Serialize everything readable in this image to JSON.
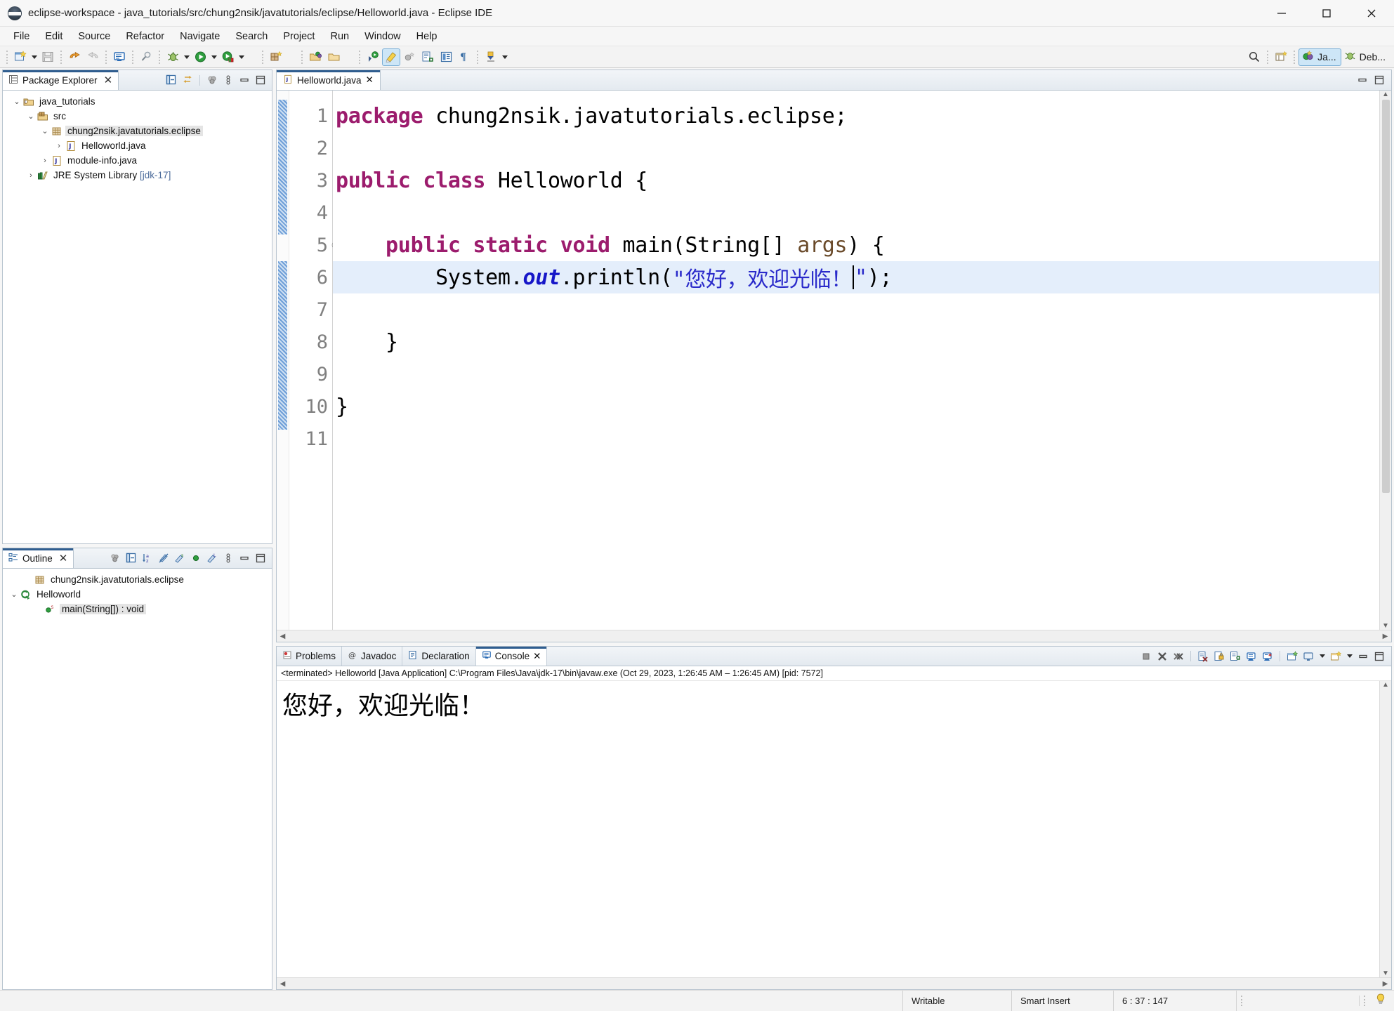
{
  "window": {
    "title": "eclipse-workspace - java_tutorials/src/chung2nsik/javatutorials/eclipse/Helloworld.java - Eclipse IDE",
    "app_icon": "eclipse-icon",
    "minimize_label": "Minimize",
    "maximize_label": "Maximize",
    "close_label": "Close"
  },
  "menubar": {
    "items": [
      {
        "label": "File"
      },
      {
        "label": "Edit"
      },
      {
        "label": "Source"
      },
      {
        "label": "Refactor"
      },
      {
        "label": "Navigate"
      },
      {
        "label": "Search"
      },
      {
        "label": "Project"
      },
      {
        "label": "Run"
      },
      {
        "label": "Window"
      },
      {
        "label": "Help"
      }
    ]
  },
  "toolbar": {
    "buttons": [
      {
        "icon": "new-wizard-icon",
        "name": "new-button"
      },
      {
        "icon": "save-icon",
        "name": "save-button"
      },
      {
        "icon": "undo-icon",
        "name": "undo-button"
      },
      {
        "icon": "redo-icon",
        "name": "redo-button"
      },
      {
        "icon": "console-icon",
        "name": "open-console-button"
      },
      {
        "icon": "search-disabled-icon",
        "name": "search-button"
      },
      {
        "icon": "debug-icon",
        "name": "debug-button"
      },
      {
        "icon": "run-icon",
        "name": "run-button"
      },
      {
        "icon": "coverage-icon",
        "name": "run-coverage-button"
      },
      {
        "icon": "new-package-icon",
        "name": "new-java-package-button"
      },
      {
        "icon": "open-type-icon",
        "name": "open-type-button"
      },
      {
        "icon": "open-task-icon",
        "name": "open-task-button"
      },
      {
        "icon": "next-annotation-icon",
        "name": "next-annotation-button"
      },
      {
        "icon": "highlight-icon",
        "name": "toggle-mark-occurrences-button"
      },
      {
        "icon": "skip-breakpoints-icon",
        "name": "skip-breakpoints-button"
      },
      {
        "icon": "link-editor-icon",
        "name": "link-with-editor-button"
      },
      {
        "icon": "show-whitespace-icon",
        "name": "show-whitespace-button"
      },
      {
        "icon": "pilcrow-icon",
        "name": "format-button"
      },
      {
        "icon": "download-icon",
        "name": "download-button"
      }
    ],
    "quick_access_icon": "search-icon",
    "open-perspective_icon": "open-perspective-icon",
    "perspectives": [
      {
        "label": "Ja...",
        "icon": "java-perspective-icon",
        "active": true
      },
      {
        "label": "Deb...",
        "icon": "debug-perspective-icon",
        "active": false
      }
    ]
  },
  "package_explorer": {
    "tab_label": "Package Explorer",
    "tab_icon": "package-explorer-icon",
    "close_icon": "close-icon",
    "tools": [
      {
        "icon": "collapse-all-icon",
        "name": "collapse-all-button"
      },
      {
        "icon": "link-with-editor-icon",
        "name": "link-with-editor-button"
      },
      {
        "icon": "view-menu-filter-icon",
        "name": "filters-button"
      },
      {
        "icon": "view-menu-icon",
        "name": "view-menu-button"
      },
      {
        "icon": "minimize-icon",
        "name": "minimize-view-button"
      },
      {
        "icon": "maximize-icon",
        "name": "maximize-view-button"
      }
    ],
    "tree": [
      {
        "label": "java_tutorials",
        "indent": 0,
        "twisty": "expanded",
        "icon": "java-project-icon",
        "selected": false,
        "suffix": ""
      },
      {
        "label": "src",
        "indent": 1,
        "twisty": "expanded",
        "icon": "source-folder-icon",
        "selected": false,
        "suffix": ""
      },
      {
        "label": "chung2nsik.javatutorials.eclipse",
        "indent": 2,
        "twisty": "expanded",
        "icon": "package-icon",
        "selected": true,
        "suffix": ""
      },
      {
        "label": "Helloworld.java",
        "indent": 3,
        "twisty": "collapsed",
        "icon": "java-file-icon",
        "selected": false,
        "suffix": ""
      },
      {
        "label": "module-info.java",
        "indent": 2,
        "twisty": "collapsed",
        "icon": "java-file-icon",
        "selected": false,
        "suffix": ""
      },
      {
        "label": "JRE System Library",
        "indent": 1,
        "twisty": "collapsed",
        "icon": "library-icon",
        "selected": false,
        "suffix": "[jdk-17]"
      }
    ]
  },
  "outline": {
    "tab_label": "Outline",
    "tab_icon": "outline-icon",
    "close_icon": "close-icon",
    "tools": [
      {
        "icon": "focus-icon",
        "name": "focus-on-active-task-button"
      },
      {
        "icon": "collapse-all-icon",
        "name": "collapse-all-button"
      },
      {
        "icon": "sort-icon",
        "name": "sort-button"
      },
      {
        "icon": "hide-fields-icon",
        "name": "hide-fields-button"
      },
      {
        "icon": "hide-static-icon",
        "name": "hide-static-button"
      },
      {
        "icon": "hide-nonpublic-icon",
        "name": "hide-non-public-button"
      },
      {
        "icon": "hide-local-icon",
        "name": "hide-local-types-button"
      },
      {
        "icon": "view-menu-icon",
        "name": "view-menu-button"
      },
      {
        "icon": "minimize-icon",
        "name": "minimize-view-button"
      },
      {
        "icon": "maximize-icon",
        "name": "maximize-view-button"
      }
    ],
    "tree": [
      {
        "label": "chung2nsik.javatutorials.eclipse",
        "indent": 1,
        "twisty": "none",
        "icon": "package-icon",
        "selected": false
      },
      {
        "label": "Helloworld",
        "indent": 0,
        "twisty": "expanded",
        "icon": "class-icon",
        "selected": false
      },
      {
        "label": "main(String[]) : void",
        "indent": 2,
        "twisty": "none",
        "icon": "method-static-icon",
        "selected": true
      }
    ]
  },
  "editor": {
    "tab_label": "Helloworld.java",
    "tab_icon": "java-file-icon",
    "close_icon": "close-icon",
    "tools": [
      {
        "icon": "minimize-icon",
        "name": "minimize-editor-button"
      },
      {
        "icon": "maximize-icon",
        "name": "maximize-editor-button"
      }
    ],
    "lines": [
      {
        "num": "1",
        "fold": "",
        "tokens": [
          {
            "t": "package ",
            "c": "kw"
          },
          {
            "t": "chung2nsik.javatutorials.eclipse;",
            "c": "cls"
          }
        ],
        "highlight": false
      },
      {
        "num": "2",
        "fold": "",
        "tokens": [],
        "highlight": false
      },
      {
        "num": "3",
        "fold": "",
        "tokens": [
          {
            "t": "public class ",
            "c": "kw"
          },
          {
            "t": "Helloworld {",
            "c": "cls"
          }
        ],
        "highlight": false
      },
      {
        "num": "4",
        "fold": "",
        "tokens": [],
        "highlight": false
      },
      {
        "num": "5",
        "fold": "collapse",
        "tokens": [
          {
            "t": "    ",
            "c": "cls"
          },
          {
            "t": "public static void ",
            "c": "kw"
          },
          {
            "t": "main(String[] ",
            "c": "cls"
          },
          {
            "t": "args",
            "c": "param"
          },
          {
            "t": ") {",
            "c": "cls"
          }
        ],
        "highlight": false
      },
      {
        "num": "6",
        "fold": "",
        "tokens": [
          {
            "t": "        System.",
            "c": "cls"
          },
          {
            "t": "out",
            "c": "fld"
          },
          {
            "t": ".println(",
            "c": "cls"
          },
          {
            "t": "\"您好，欢迎光临！",
            "c": "str"
          },
          {
            "t": "§caret§",
            "c": "caret"
          },
          {
            "t": "\"",
            "c": "str"
          },
          {
            "t": ");",
            "c": "cls"
          }
        ],
        "highlight": true
      },
      {
        "num": "7",
        "fold": "",
        "tokens": [],
        "highlight": false
      },
      {
        "num": "8",
        "fold": "",
        "tokens": [
          {
            "t": "    }",
            "c": "cls"
          }
        ],
        "highlight": false
      },
      {
        "num": "9",
        "fold": "",
        "tokens": [],
        "highlight": false
      },
      {
        "num": "10",
        "fold": "",
        "tokens": [
          {
            "t": "}",
            "c": "cls"
          }
        ],
        "highlight": false
      },
      {
        "num": "11",
        "fold": "",
        "tokens": [],
        "highlight": false
      }
    ]
  },
  "console": {
    "tabs": [
      {
        "label": "Problems",
        "icon": "problems-icon",
        "active": false
      },
      {
        "label": "Javadoc",
        "icon": "javadoc-icon",
        "active": false
      },
      {
        "label": "Declaration",
        "icon": "declaration-icon",
        "active": false
      },
      {
        "label": "Console",
        "icon": "console-icon",
        "active": true
      }
    ],
    "close_icon": "close-icon",
    "header": "<terminated> Helloworld [Java Application] C:\\Program Files\\Java\\jdk-17\\bin\\javaw.exe  (Oct 29, 2023, 1:26:45 AM – 1:26:45 AM) [pid: 7572]",
    "output": "您好，欢迎光临！",
    "tools": [
      {
        "icon": "terminate-icon",
        "name": "terminate-button"
      },
      {
        "icon": "remove-launch-icon",
        "name": "remove-launch-button"
      },
      {
        "icon": "remove-all-launches-icon",
        "name": "remove-all-terminated-button"
      },
      {
        "icon": "clear-console-icon",
        "name": "clear-console-button"
      },
      {
        "icon": "scroll-lock-icon",
        "name": "scroll-lock-button"
      },
      {
        "icon": "word-wrap-icon",
        "name": "word-wrap-button"
      },
      {
        "icon": "show-console-output-icon",
        "name": "show-console-on-output-button"
      },
      {
        "icon": "show-console-error-icon",
        "name": "show-console-on-error-button"
      },
      {
        "icon": "pin-console-icon",
        "name": "pin-console-button"
      },
      {
        "icon": "display-console-icon",
        "name": "display-selected-console-button"
      },
      {
        "icon": "new-console-icon",
        "name": "open-console-button"
      },
      {
        "icon": "minimize-icon",
        "name": "minimize-view-button"
      },
      {
        "icon": "maximize-icon",
        "name": "maximize-view-button"
      }
    ]
  },
  "statusbar": {
    "writable": "Writable",
    "insert_mode": "Smart Insert",
    "position": "6 : 37 : 147",
    "tip_icon": "lightbulb-icon"
  },
  "colors": {
    "keyword": "#9c1c6d",
    "string": "#2a2aca",
    "field": "#1616c8",
    "parameter": "#6a4a2a",
    "line_highlight": "#e4eefb",
    "tab_accent": "#2f5d8f",
    "selection": "#cde6f7"
  }
}
